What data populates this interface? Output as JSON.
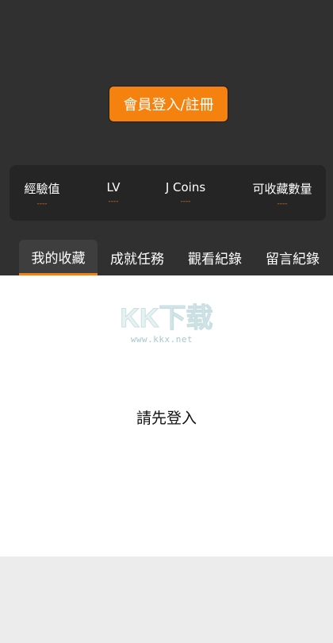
{
  "header": {
    "login_button_label": "會員登入/註冊"
  },
  "stats": [
    {
      "label": "經驗值",
      "value": "----"
    },
    {
      "label": "LV",
      "value": "----"
    },
    {
      "label": "J Coins",
      "value": "----"
    },
    {
      "label": "可收藏數量",
      "value": "----"
    }
  ],
  "tabs": [
    {
      "label": "我的收藏",
      "active": true
    },
    {
      "label": "成就任務",
      "active": false
    },
    {
      "label": "觀看紀錄",
      "active": false
    },
    {
      "label": "留言紀錄",
      "active": false
    }
  ],
  "content": {
    "empty_message": "請先登入"
  },
  "watermark": {
    "logo_text": "KK下载",
    "url": "www.kkx.net"
  },
  "colors": {
    "accent": "#f5820f",
    "header_bg": "#303030",
    "card_bg": "#252525"
  }
}
